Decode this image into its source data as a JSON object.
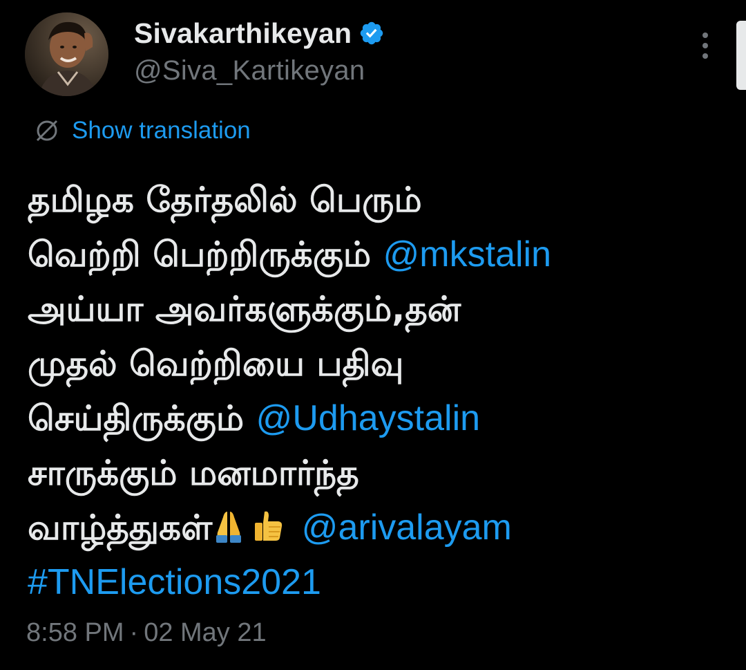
{
  "author": {
    "display_name": "Sivakarthikeyan",
    "handle": "@Siva_Kartikeyan",
    "verified": true,
    "verified_icon": "verified-badge-icon",
    "avatar": "profile-photo"
  },
  "menu_icon": "more-vertical-icon",
  "translation": {
    "icon": "globe-icon",
    "label": "Show translation"
  },
  "tweet": {
    "line1": "தமிழக தேர்தலில் பெரும்",
    "line2_text": "வெற்றி பெற்றிருக்கும் ",
    "line2_mention": "@mkstalin",
    "line3": "அய்யா அவர்களுக்கும்,தன்",
    "line4": "முதல் வெற்றியை பதிவு",
    "line5_text": "செய்திருக்கும் ",
    "line5_mention": "@Udhaystalin",
    "line6": "சாருக்கும் மனமார்ந்த",
    "line7_text": "வாழ்த்துகள்",
    "line7_emojis": [
      "folded-hands-icon",
      "thumbs-up-icon"
    ],
    "line7_mention": "@arivalayam",
    "hashtag": "#TNElections2021"
  },
  "meta": {
    "time": "8:58 PM",
    "separator": "·",
    "date": "02 May 21"
  },
  "colors": {
    "background": "#000000",
    "text": "#e7e9ea",
    "secondary": "#71767b",
    "accent": "#1d9bf0"
  }
}
